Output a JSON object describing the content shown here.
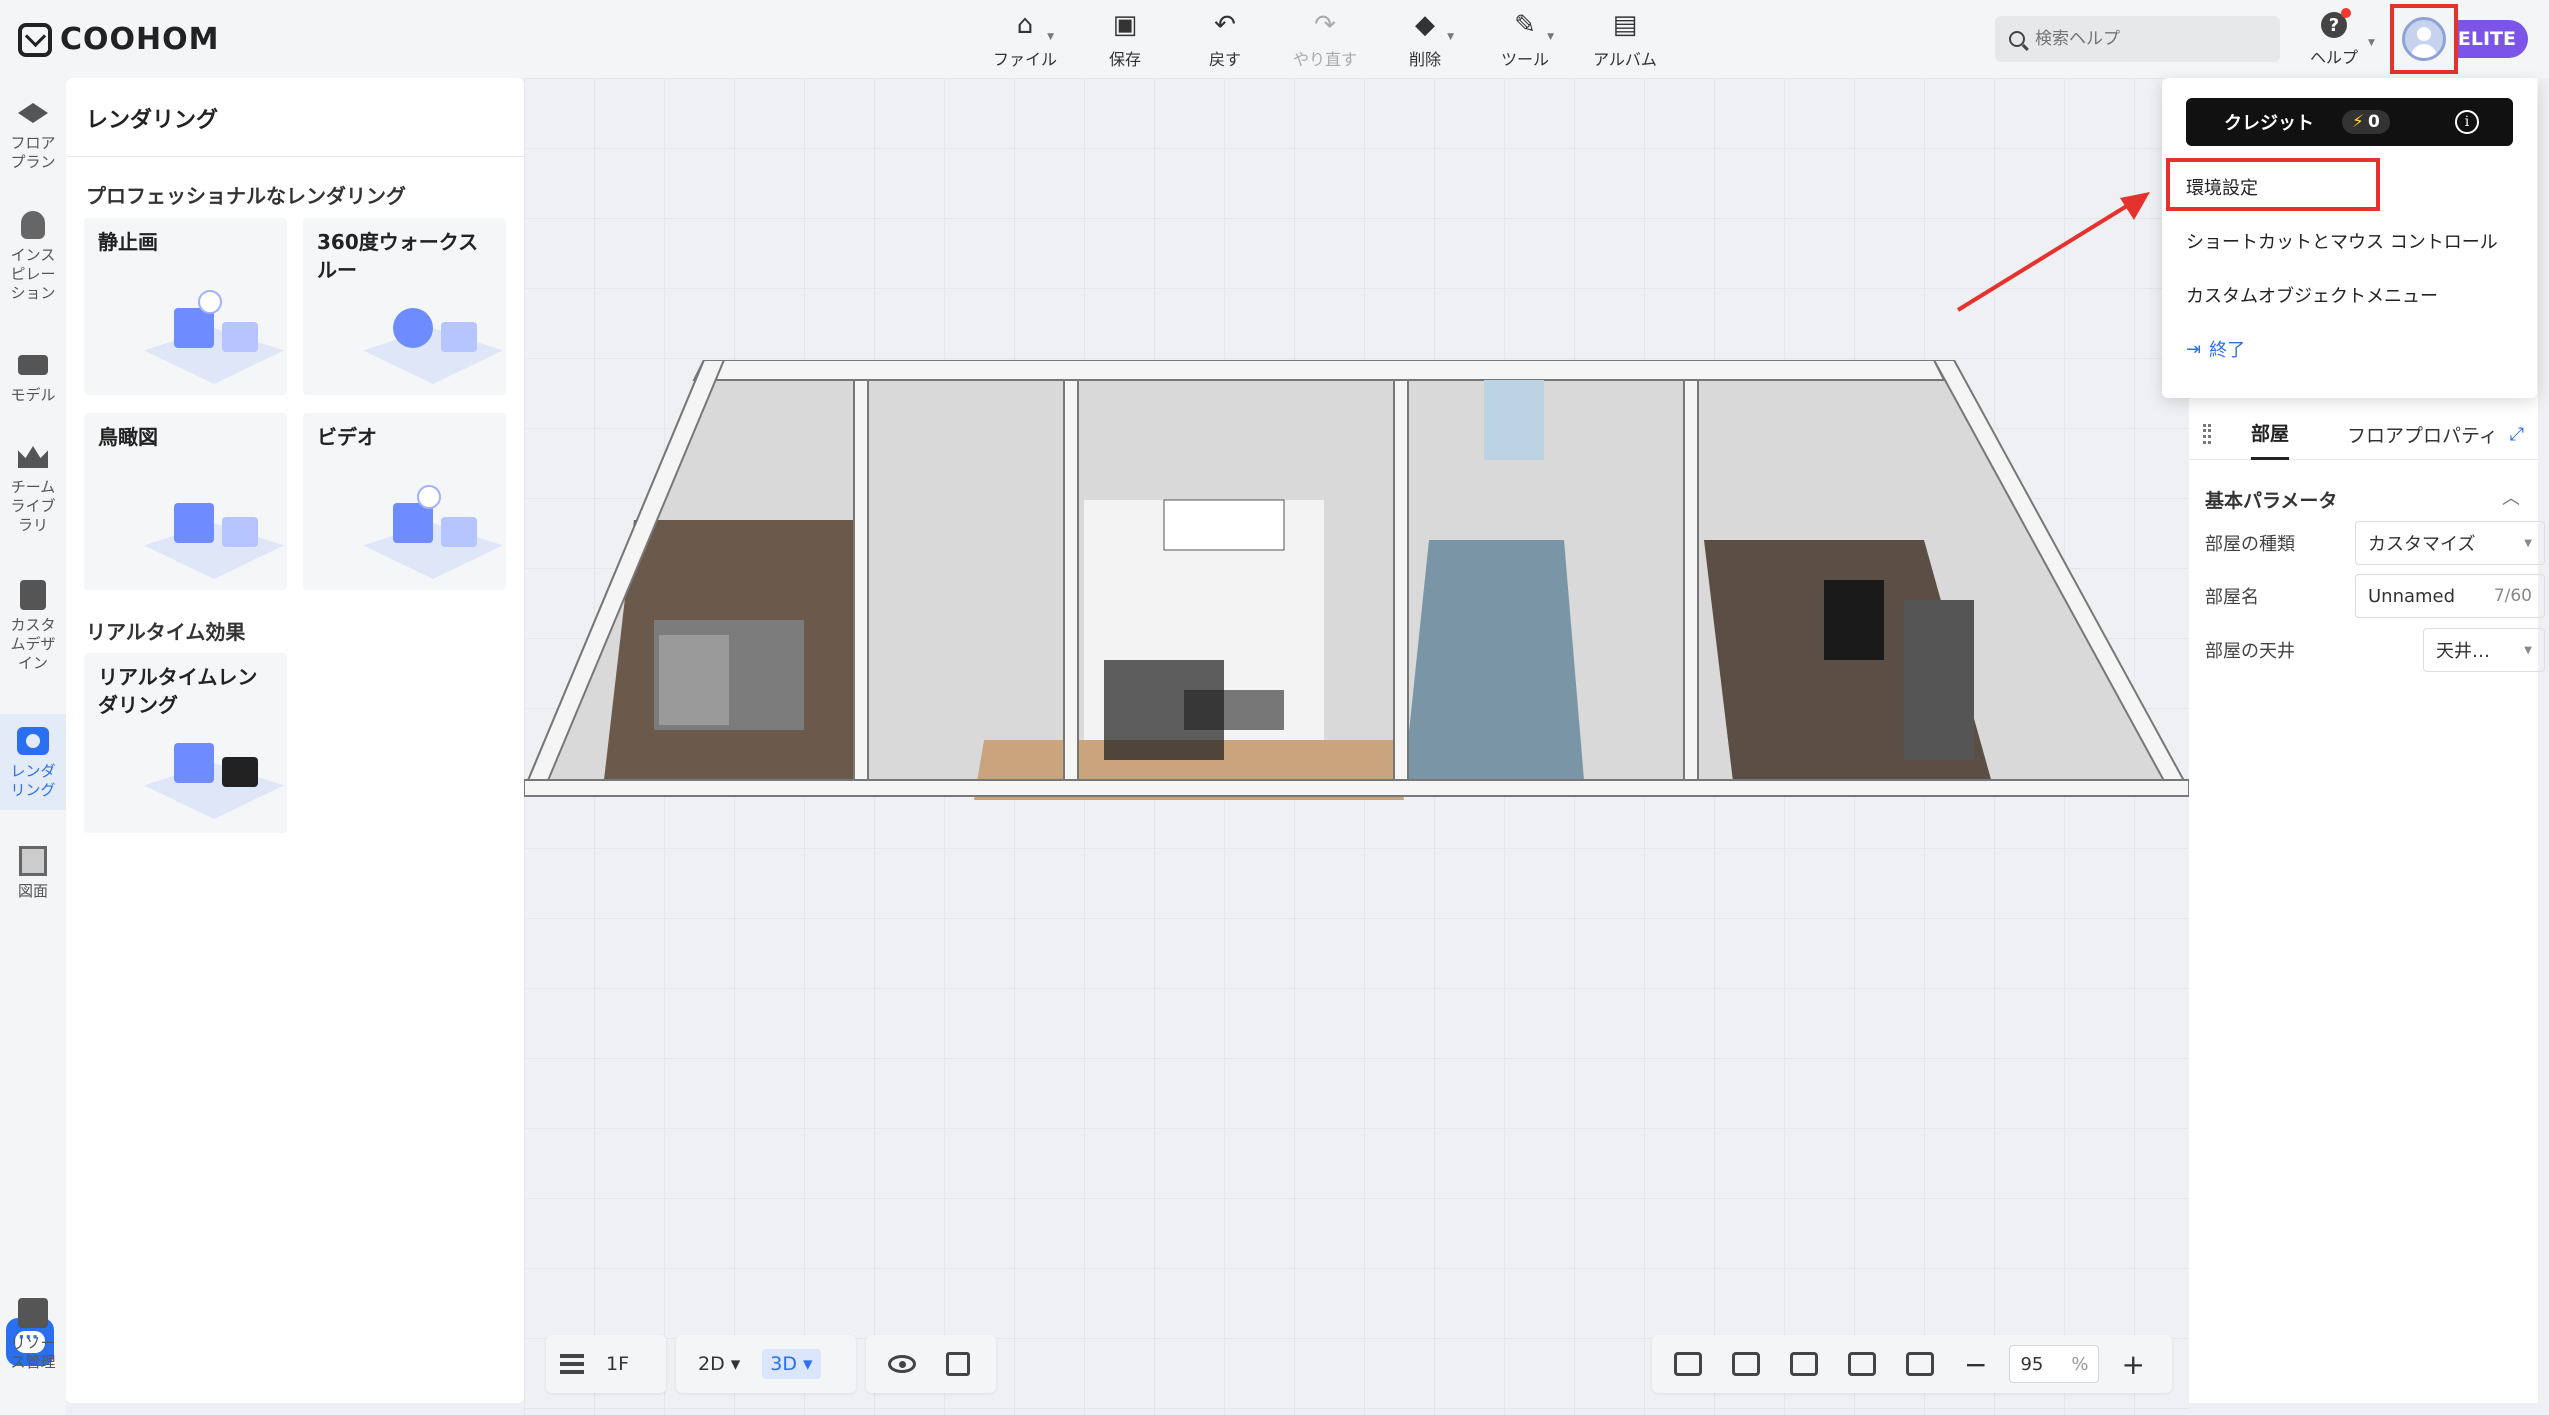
{
  "app": {
    "logo_text": "COOHOM"
  },
  "toolbar": {
    "items": [
      {
        "label": "ファイル",
        "icon": "home-file-icon",
        "has_caret": true
      },
      {
        "label": "保存",
        "icon": "save-icon"
      },
      {
        "label": "戻す",
        "icon": "undo-icon"
      },
      {
        "label": "やり直す",
        "icon": "redo-icon",
        "disabled": true
      },
      {
        "label": "削除",
        "icon": "eraser-icon",
        "has_caret": true
      },
      {
        "label": "ツール",
        "icon": "wrench-icon",
        "has_caret": true
      },
      {
        "label": "アルバム",
        "icon": "album-icon"
      }
    ]
  },
  "search": {
    "placeholder": "検索ヘルプ"
  },
  "help": {
    "label": "ヘルプ"
  },
  "badge": {
    "text": "ELITE",
    "color": "#7a55e8"
  },
  "leftnav": {
    "items": [
      {
        "label": "フロア\nプラン",
        "icon": "floorplan-icon"
      },
      {
        "label": "インス\nピレー\nション",
        "icon": "bulb-icon"
      },
      {
        "label": "モデル",
        "icon": "sofa-icon"
      },
      {
        "label": "チーム\nライブ\nラリ",
        "icon": "crown-icon"
      },
      {
        "label": "カスタ\nムデザ\nイン",
        "icon": "cabinet-icon"
      },
      {
        "label": "レンダ\nリング",
        "icon": "camera-icon",
        "active": true
      },
      {
        "label": "図面",
        "icon": "drawing-icon"
      }
    ],
    "resource_label": "リソー\nス管理"
  },
  "render_panel": {
    "title": "レンダリング",
    "section_pro": "プロフェッショナルなレンダリング",
    "cards": [
      {
        "title": "静止画"
      },
      {
        "title": "360度ウォークス\nルー"
      },
      {
        "title": "鳥瞰図"
      },
      {
        "title": "ビデオ"
      }
    ],
    "section_rt": "リアルタイム効果",
    "rt_card": {
      "title": "リアルタイムレン\nダリング"
    }
  },
  "bottom_left": {
    "floor": "1F",
    "mode_2d": "2D",
    "mode_3d": "3D"
  },
  "zoom": {
    "value": "95",
    "unit": "%"
  },
  "user_menu": {
    "credit_label": "クレジット",
    "credit_value": "0",
    "items": [
      {
        "label": "環境設定",
        "highlighted": true
      },
      {
        "label": "ショートカットとマウス コントロール"
      },
      {
        "label": "カスタムオブジェクトメニュー"
      }
    ],
    "exit_label": "終了"
  },
  "right_panel": {
    "tabs": [
      {
        "label": "部屋",
        "active": true
      },
      {
        "label": "フロアプロパティ"
      }
    ],
    "section_title": "基本パラメータ",
    "rows": [
      {
        "label": "部屋の種類",
        "value": "カスタマイズ"
      },
      {
        "label": "部屋名",
        "value": "Unnamed",
        "count": "7/60"
      },
      {
        "label": "部屋の天井",
        "value": "天井…"
      }
    ]
  },
  "colors": {
    "accent": "#2a6ff0",
    "highlight": "#e6322c"
  }
}
